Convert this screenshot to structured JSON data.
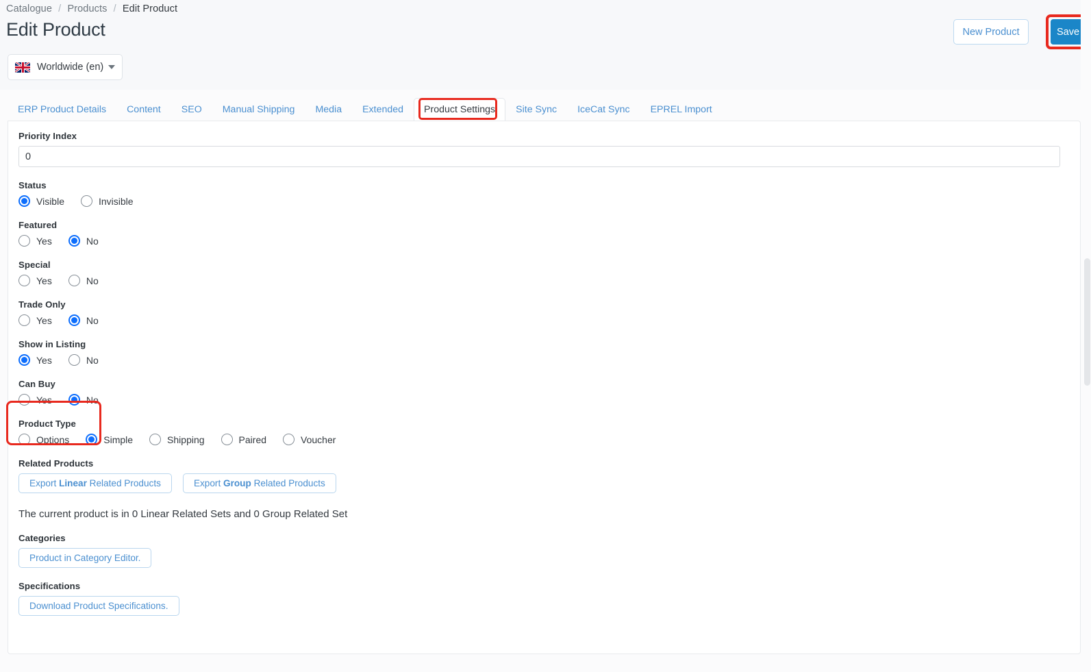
{
  "breadcrumb": {
    "items": [
      "Catalogue",
      "Products",
      "Edit Product"
    ],
    "separator": "/"
  },
  "header": {
    "title": "Edit Product",
    "locale_label": "Worldwide (en)",
    "locale_flag_icon": "uk-flag-icon",
    "new_product_label": "New Product",
    "save_label": "Save",
    "accent_blue": "#1b86c8",
    "highlight_red": "#e8291e"
  },
  "tabs": [
    {
      "label": "ERP Product Details",
      "active": false
    },
    {
      "label": "Content",
      "active": false
    },
    {
      "label": "SEO",
      "active": false
    },
    {
      "label": "Manual Shipping",
      "active": false
    },
    {
      "label": "Media",
      "active": false
    },
    {
      "label": "Extended",
      "active": false
    },
    {
      "label": "Product Settings",
      "active": true
    },
    {
      "label": "Site Sync",
      "active": false
    },
    {
      "label": "IceCat Sync",
      "active": false
    },
    {
      "label": "EPREL Import",
      "active": false
    }
  ],
  "form": {
    "priority_index": {
      "label": "Priority Index",
      "value": "0"
    },
    "status": {
      "label": "Status",
      "options": [
        {
          "label": "Visible",
          "checked": true
        },
        {
          "label": "Invisible",
          "checked": false
        }
      ]
    },
    "featured": {
      "label": "Featured",
      "options": [
        {
          "label": "Yes",
          "checked": false
        },
        {
          "label": "No",
          "checked": true
        }
      ]
    },
    "special": {
      "label": "Special",
      "options": [
        {
          "label": "Yes",
          "checked": false
        },
        {
          "label": "No",
          "checked": false
        }
      ]
    },
    "trade_only": {
      "label": "Trade Only",
      "options": [
        {
          "label": "Yes",
          "checked": false
        },
        {
          "label": "No",
          "checked": true
        }
      ]
    },
    "show_in_listing": {
      "label": "Show in Listing",
      "options": [
        {
          "label": "Yes",
          "checked": true
        },
        {
          "label": "No",
          "checked": false
        }
      ]
    },
    "can_buy": {
      "label": "Can Buy",
      "highlighted": true,
      "options": [
        {
          "label": "Yes",
          "checked": false
        },
        {
          "label": "No",
          "checked": true
        }
      ]
    },
    "product_type": {
      "label": "Product Type",
      "options": [
        {
          "label": "Options",
          "checked": false
        },
        {
          "label": "Simple",
          "checked": true
        },
        {
          "label": "Shipping",
          "checked": false
        },
        {
          "label": "Paired",
          "checked": false
        },
        {
          "label": "Voucher",
          "checked": false
        }
      ]
    },
    "related_products": {
      "label": "Related Products",
      "export_linear": {
        "pre": "Export ",
        "bold": "Linear",
        "post": " Related Products"
      },
      "export_group": {
        "pre": "Export ",
        "bold": "Group",
        "post": " Related Products"
      },
      "info": "The current product is in 0 Linear Related Sets and 0 Group Related Set"
    },
    "categories": {
      "label": "Categories",
      "button_label": "Product in Category Editor."
    },
    "specifications": {
      "label": "Specifications",
      "button_label": "Download Product Specifications."
    }
  }
}
